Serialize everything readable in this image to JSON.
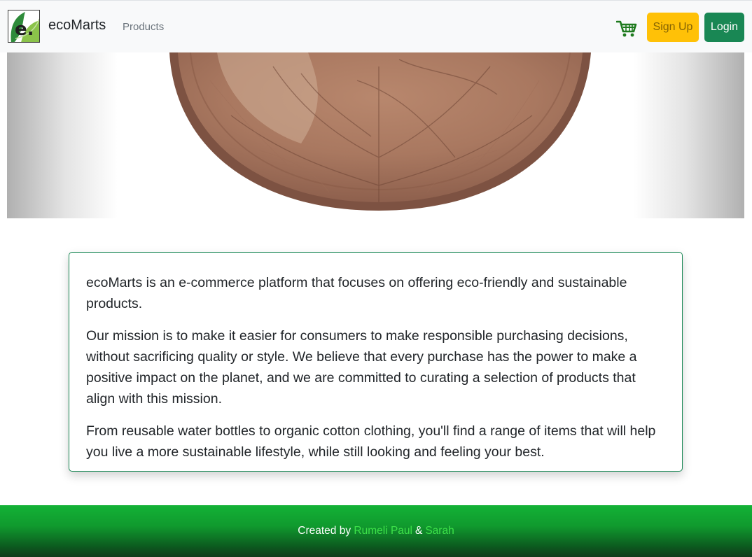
{
  "navbar": {
    "logo_letter": "e.",
    "brand": "ecoMarts",
    "products_link": "Products",
    "cart_icon": "cart-icon",
    "signup_label": "Sign Up",
    "login_label": "Login"
  },
  "banner": {
    "image": "leaf-plate-image"
  },
  "about": {
    "paragraphs": [
      "ecoMarts is an e-commerce platform that focuses on offering eco-friendly and sustainable products.",
      "Our mission is to make it easier for consumers to make responsible purchasing decisions, without sacrificing quality or style. We believe that every purchase has the power to make a positive impact on the planet, and we are committed to curating a selection of products that align with this mission.",
      "From reusable water bottles to organic cotton clothing, you'll find a range of items that will help you live a more sustainable lifestyle, while still looking and feeling your best."
    ]
  },
  "footer": {
    "prefix": "Created by",
    "author1": "Rumeli Paul",
    "separator": "&",
    "author2": "Sarah"
  },
  "colors": {
    "brand_green": "#198754",
    "signup_yellow": "#ffc107",
    "author_link": "#3ee24a"
  }
}
